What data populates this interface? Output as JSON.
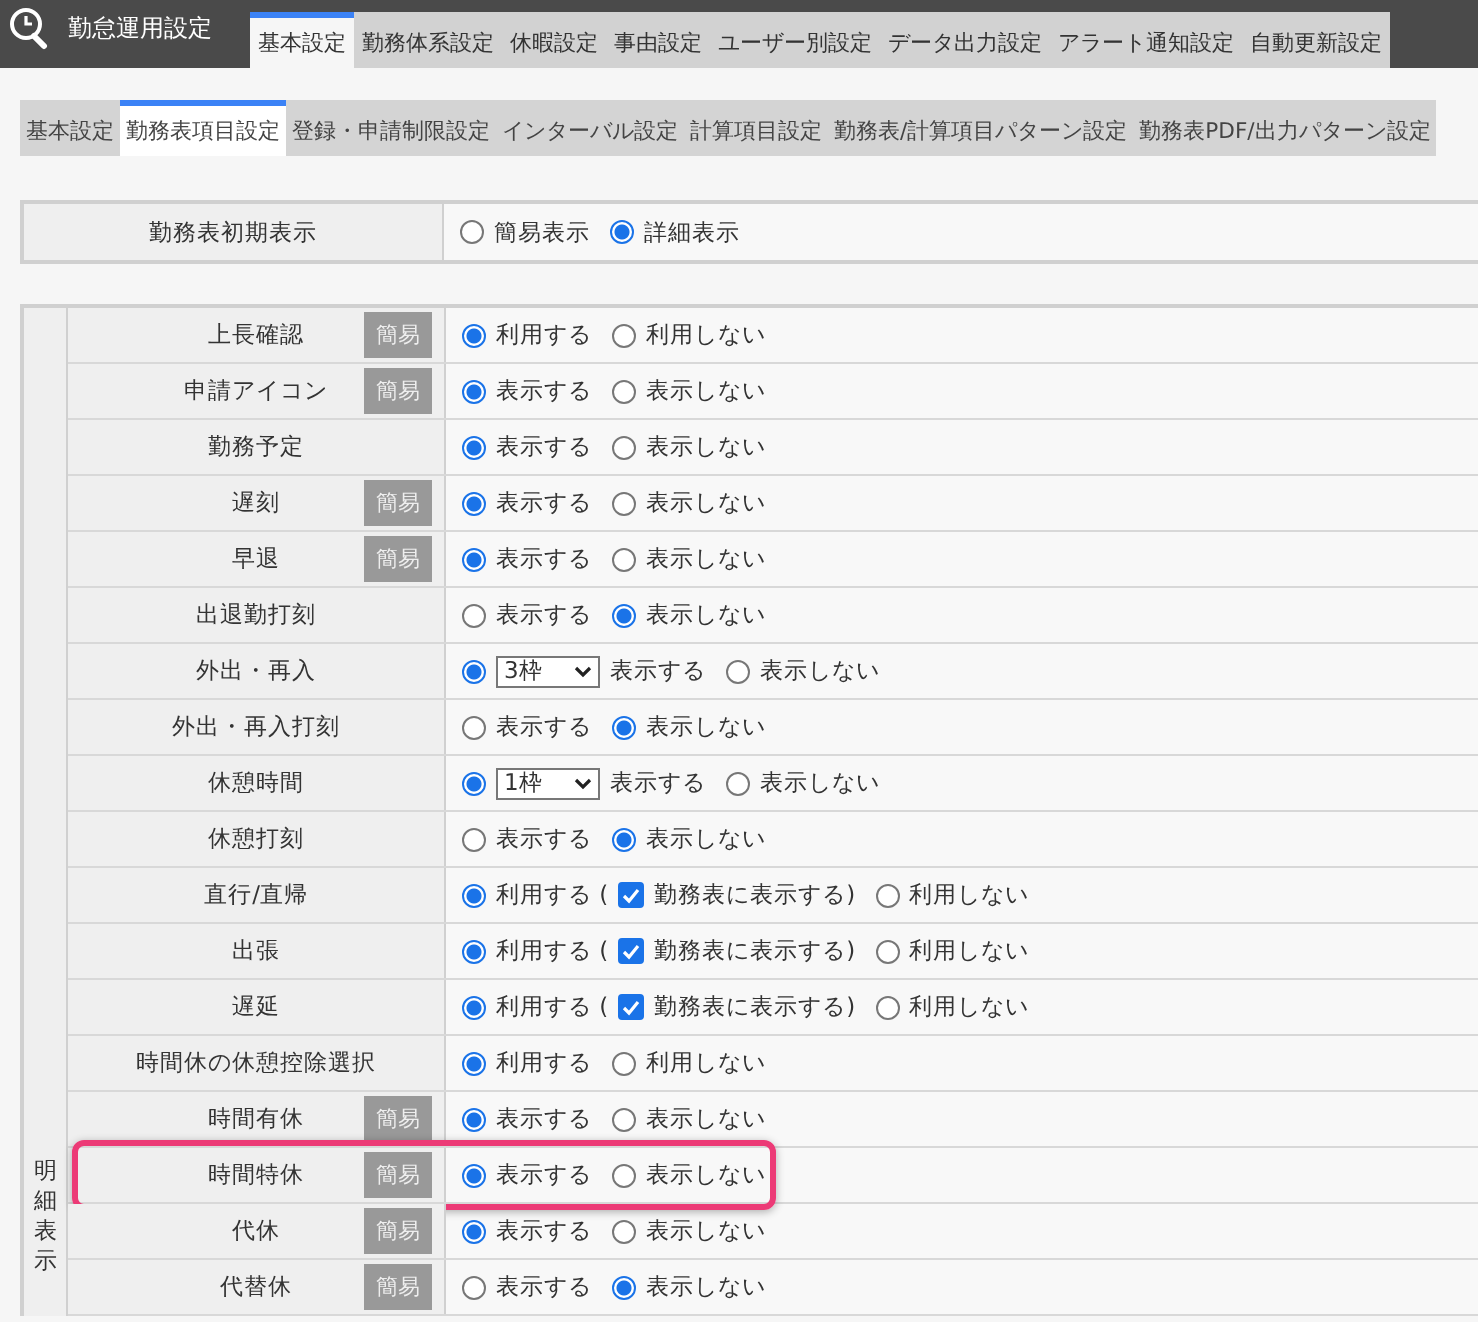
{
  "header": {
    "title": "勤怠運用設定"
  },
  "tabs": [
    {
      "label": "基本設定",
      "selected": true
    },
    {
      "label": "勤務体系設定",
      "selected": false
    },
    {
      "label": "休暇設定",
      "selected": false
    },
    {
      "label": "事由設定",
      "selected": false
    },
    {
      "label": "ユーザー別設定",
      "selected": false
    },
    {
      "label": "データ出力設定",
      "selected": false
    },
    {
      "label": "アラート通知設定",
      "selected": false
    },
    {
      "label": "自動更新設定",
      "selected": false
    }
  ],
  "subtabs": [
    {
      "label": "基本設定",
      "selected": false
    },
    {
      "label": "勤務表項目設定",
      "selected": true
    },
    {
      "label": "登録・申請制限設定",
      "selected": false
    },
    {
      "label": "インターバル設定",
      "selected": false
    },
    {
      "label": "計算項目設定",
      "selected": false
    },
    {
      "label": "勤務表/計算項目パターン設定",
      "selected": false
    },
    {
      "label": "勤務表PDF/出力パターン設定",
      "selected": false
    }
  ],
  "initial_view": {
    "label": "勤務表初期表示",
    "options": [
      {
        "label": "簡易表示",
        "selected": false
      },
      {
        "label": "詳細表示",
        "selected": true
      }
    ]
  },
  "detail": {
    "group_label": "明細表示",
    "rows": [
      {
        "label": "上長確認",
        "badge": "簡易",
        "highlighted": false,
        "options": [
          {
            "label": "利用する",
            "selected": true
          },
          {
            "label": "利用しない",
            "selected": false
          }
        ]
      },
      {
        "label": "申請アイコン",
        "badge": "簡易",
        "highlighted": false,
        "options": [
          {
            "label": "表示する",
            "selected": true
          },
          {
            "label": "表示しない",
            "selected": false
          }
        ]
      },
      {
        "label": "勤務予定",
        "highlighted": false,
        "options": [
          {
            "label": "表示する",
            "selected": true
          },
          {
            "label": "表示しない",
            "selected": false
          }
        ]
      },
      {
        "label": "遅刻",
        "badge": "簡易",
        "highlighted": false,
        "options": [
          {
            "label": "表示する",
            "selected": true
          },
          {
            "label": "表示しない",
            "selected": false
          }
        ]
      },
      {
        "label": "早退",
        "badge": "簡易",
        "highlighted": false,
        "options": [
          {
            "label": "表示する",
            "selected": true
          },
          {
            "label": "表示しない",
            "selected": false
          }
        ]
      },
      {
        "label": "出退勤打刻",
        "highlighted": false,
        "options": [
          {
            "label": "表示する",
            "selected": false
          },
          {
            "label": "表示しない",
            "selected": true
          }
        ]
      },
      {
        "label": "外出・再入",
        "highlighted": false,
        "options": [
          {
            "label": "表示する",
            "selected": true,
            "select": "3枠"
          },
          {
            "label": "表示しない",
            "selected": false
          }
        ]
      },
      {
        "label": "外出・再入打刻",
        "highlighted": false,
        "options": [
          {
            "label": "表示する",
            "selected": false
          },
          {
            "label": "表示しない",
            "selected": true
          }
        ]
      },
      {
        "label": "休憩時間",
        "highlighted": false,
        "options": [
          {
            "label": "表示する",
            "selected": true,
            "select": "1枠"
          },
          {
            "label": "表示しない",
            "selected": false
          }
        ]
      },
      {
        "label": "休憩打刻",
        "highlighted": false,
        "options": [
          {
            "label": "表示する",
            "selected": false
          },
          {
            "label": "表示しない",
            "selected": true
          }
        ]
      },
      {
        "label": "直行/直帰",
        "highlighted": false,
        "options": [
          {
            "label": "利用する (",
            "selected": true,
            "checkbox": {
              "label": "勤務表に表示する)",
              "checked": true
            }
          },
          {
            "label": "利用しない",
            "selected": false
          }
        ]
      },
      {
        "label": "出張",
        "highlighted": false,
        "options": [
          {
            "label": "利用する (",
            "selected": true,
            "checkbox": {
              "label": "勤務表に表示する)",
              "checked": true
            }
          },
          {
            "label": "利用しない",
            "selected": false
          }
        ]
      },
      {
        "label": "遅延",
        "highlighted": false,
        "options": [
          {
            "label": "利用する (",
            "selected": true,
            "checkbox": {
              "label": "勤務表に表示する)",
              "checked": true
            }
          },
          {
            "label": "利用しない",
            "selected": false
          }
        ]
      },
      {
        "label": "時間休の休憩控除選択",
        "highlighted": false,
        "options": [
          {
            "label": "利用する",
            "selected": true
          },
          {
            "label": "利用しない",
            "selected": false
          }
        ]
      },
      {
        "label": "時間有休",
        "badge": "簡易",
        "highlighted": false,
        "options": [
          {
            "label": "表示する",
            "selected": true
          },
          {
            "label": "表示しない",
            "selected": false
          }
        ]
      },
      {
        "label": "時間特休",
        "badge": "簡易",
        "highlighted": true,
        "options": [
          {
            "label": "表示する",
            "selected": true
          },
          {
            "label": "表示しない",
            "selected": false
          }
        ]
      },
      {
        "label": "代休",
        "badge": "簡易",
        "highlighted": false,
        "options": [
          {
            "label": "表示する",
            "selected": true
          },
          {
            "label": "表示しない",
            "selected": false
          }
        ]
      },
      {
        "label": "代替休",
        "badge": "簡易",
        "highlighted": false,
        "options": [
          {
            "label": "表示する",
            "selected": false
          },
          {
            "label": "表示しない",
            "selected": true
          }
        ]
      }
    ]
  }
}
